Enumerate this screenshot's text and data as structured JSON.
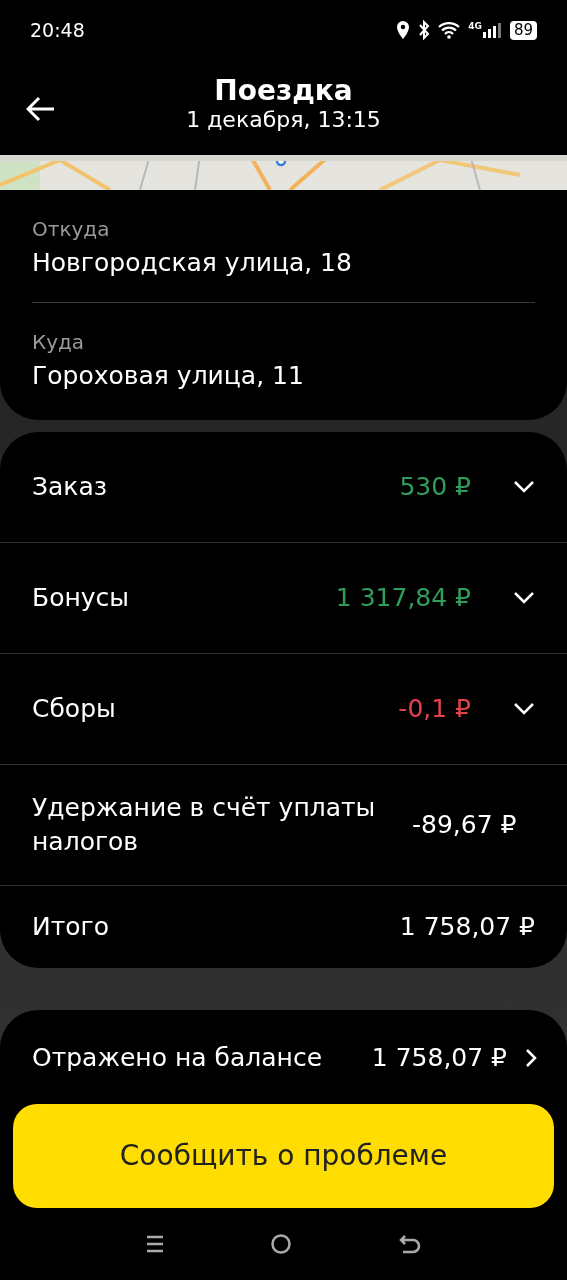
{
  "status_bar": {
    "time": "20:48",
    "network": "4G",
    "battery": "89"
  },
  "header": {
    "title": "Поездка",
    "subtitle": "1 декабря, 13:15"
  },
  "route": [
    {
      "label": "Откуда",
      "address": "Новгородская улица, 18"
    },
    {
      "label": "Куда",
      "address": "Гороховая улица, 11"
    }
  ],
  "breakdown": [
    {
      "label": "Заказ",
      "amount": "530 ₽",
      "color": "#2f9d5c",
      "expandable": true
    },
    {
      "label": "Бонусы",
      "amount": "1 317,84 ₽",
      "color": "#2f9d5c",
      "expandable": true
    },
    {
      "label": "Сборы",
      "amount": "-0,1 ₽",
      "color": "#e2434b",
      "expandable": true
    },
    {
      "label": "Удержание в счёт уплаты налогов",
      "amount": "-89,67 ₽",
      "color": "#ffffff",
      "expandable": false
    },
    {
      "label": "Итого",
      "amount": "1 758,07 ₽",
      "color": "#ffffff",
      "expandable": false
    }
  ],
  "balance": {
    "label": "Отражено на балансе",
    "amount": "1 758,07 ₽"
  },
  "report_button": "Сообщить о проблеме"
}
